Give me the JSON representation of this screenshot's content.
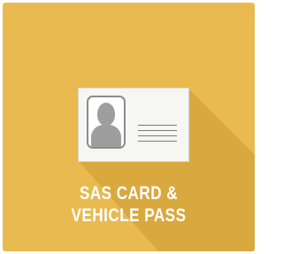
{
  "tile": {
    "title_line1": "SAS CARD &",
    "title_line2": "VEHICLE PASS",
    "icon": "id-card-icon",
    "background_color": "#e8ba50",
    "shadow_color": "#d9a93f"
  }
}
